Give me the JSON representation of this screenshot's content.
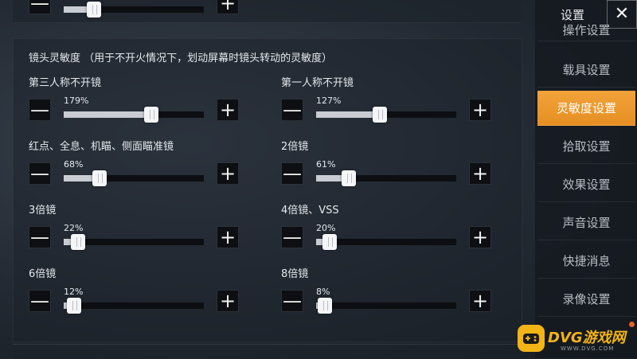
{
  "section_title": "镜头灵敏度  （用于不开火情况下，划动屏幕时镜头转动的灵敏度）",
  "buttons": {
    "minus": "—",
    "plus": "+"
  },
  "sliders": [
    {
      "label": "第三人称不开镜",
      "percent_text": "179%",
      "fill": 0.59
    },
    {
      "label": "第一人称不开镜",
      "percent_text": "127%",
      "fill": 0.42
    },
    {
      "label": "红点、全息、机瞄、侧面瞄准镜",
      "percent_text": "68%",
      "fill": 0.22
    },
    {
      "label": "2倍镜",
      "percent_text": "61%",
      "fill": 0.2
    },
    {
      "label": "3倍镜",
      "percent_text": "22%",
      "fill": 0.07
    },
    {
      "label": "4倍镜、VSS",
      "percent_text": "20%",
      "fill": 0.06
    },
    {
      "label": "6倍镜",
      "percent_text": "12%",
      "fill": 0.04
    },
    {
      "label": "8倍镜",
      "percent_text": "8%",
      "fill": 0.03
    }
  ],
  "top_slider_fill": 0.18,
  "sidebar": {
    "title": "设置",
    "close": "✕",
    "partial_item": "操作设置",
    "items": [
      {
        "label": "载具设置",
        "active": false
      },
      {
        "label": "灵敏度设置",
        "active": true
      },
      {
        "label": "拾取设置",
        "active": false
      },
      {
        "label": "效果设置",
        "active": false
      },
      {
        "label": "声音设置",
        "active": false
      },
      {
        "label": "快捷消息",
        "active": false
      },
      {
        "label": "录像设置",
        "active": false
      }
    ]
  },
  "watermark": {
    "brand": "DVG游戏网",
    "url": "WWW.DVG.COM"
  },
  "colors": {
    "accent": "#f0a033",
    "track": "#0c0e11",
    "button_bg": "#0d0f12",
    "watermark": "#f3b416"
  }
}
